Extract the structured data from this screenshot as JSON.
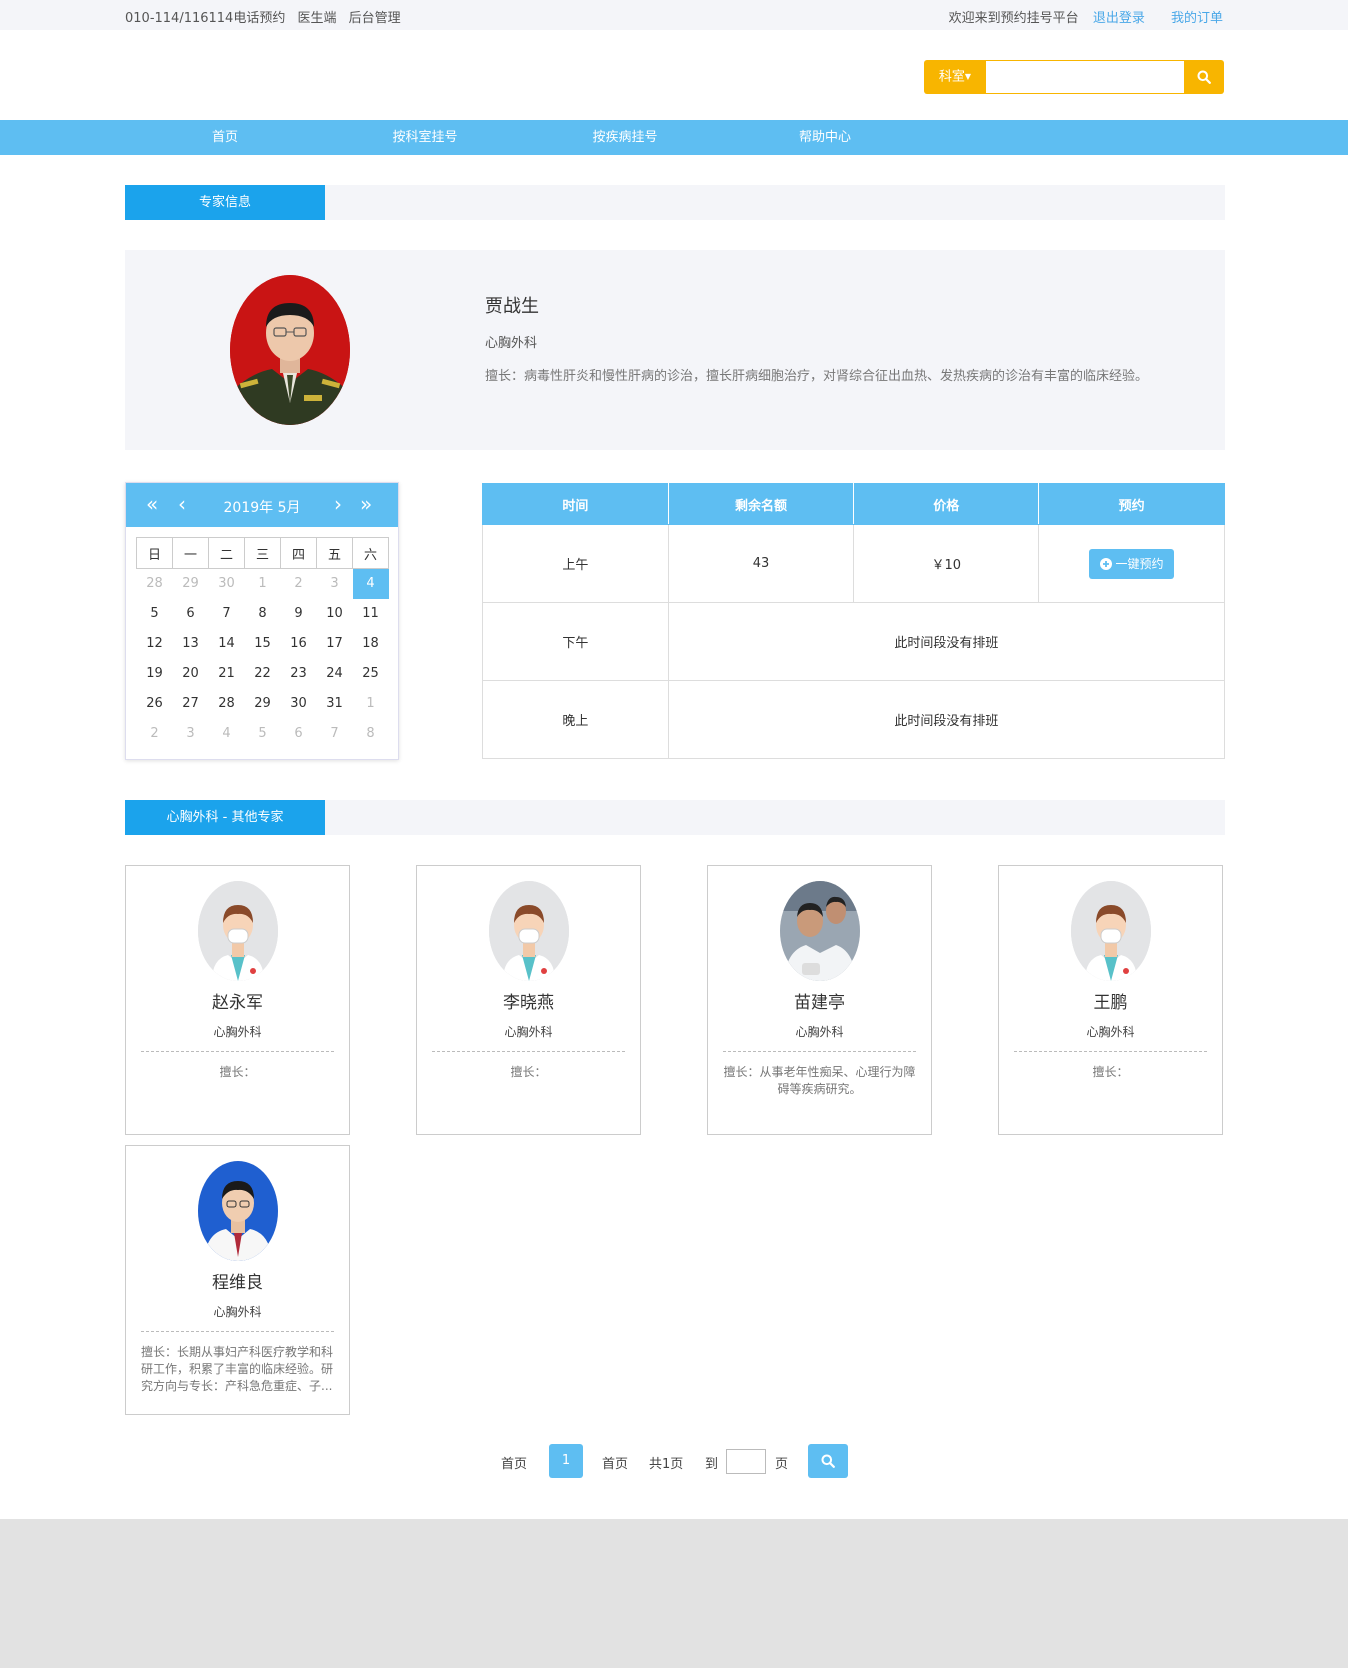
{
  "topbar": {
    "phone": "010-114/116114电话预约",
    "doctor_link": "医生端",
    "admin_link": "后台管理",
    "welcome": "欢迎来到预约挂号平台",
    "logout": "退出登录",
    "orders": "我的订单"
  },
  "search": {
    "dept_label": "科室",
    "placeholder": ""
  },
  "nav": [
    "首页",
    "按科室挂号",
    "按疾病挂号",
    "帮助中心"
  ],
  "sections": {
    "expert_info": "专家信息",
    "others": "心胸外科 - 其他专家"
  },
  "doctor": {
    "name": "贾战生",
    "dept": "心胸外科",
    "specialty": "擅长：病毒性肝炎和慢性肝病的诊治，擅长肝病细胞治疗，对肾综合征出血热、发热疾病的诊治有丰富的临床经验。"
  },
  "calendar": {
    "year_month": "2019年  5月",
    "weekdays": [
      "日",
      "一",
      "二",
      "三",
      "四",
      "五",
      "六"
    ],
    "weeks": [
      [
        {
          "d": "28",
          "m": 1
        },
        {
          "d": "29",
          "m": 1
        },
        {
          "d": "30",
          "m": 1
        },
        {
          "d": "1",
          "m": 1
        },
        {
          "d": "2",
          "m": 1
        },
        {
          "d": "3",
          "m": 1
        },
        {
          "d": "4",
          "s": 1
        }
      ],
      [
        {
          "d": "5"
        },
        {
          "d": "6"
        },
        {
          "d": "7"
        },
        {
          "d": "8"
        },
        {
          "d": "9"
        },
        {
          "d": "10"
        },
        {
          "d": "11"
        }
      ],
      [
        {
          "d": "12"
        },
        {
          "d": "13"
        },
        {
          "d": "14"
        },
        {
          "d": "15"
        },
        {
          "d": "16"
        },
        {
          "d": "17"
        },
        {
          "d": "18"
        }
      ],
      [
        {
          "d": "19"
        },
        {
          "d": "20"
        },
        {
          "d": "21"
        },
        {
          "d": "22"
        },
        {
          "d": "23"
        },
        {
          "d": "24"
        },
        {
          "d": "25"
        }
      ],
      [
        {
          "d": "26"
        },
        {
          "d": "27"
        },
        {
          "d": "28"
        },
        {
          "d": "29"
        },
        {
          "d": "30"
        },
        {
          "d": "31"
        },
        {
          "d": "1",
          "m": 1
        }
      ],
      [
        {
          "d": "2",
          "m": 1
        },
        {
          "d": "3",
          "m": 1
        },
        {
          "d": "4",
          "m": 1
        },
        {
          "d": "5",
          "m": 1
        },
        {
          "d": "6",
          "m": 1
        },
        {
          "d": "7",
          "m": 1
        },
        {
          "d": "8",
          "m": 1
        }
      ]
    ]
  },
  "schedule": {
    "headers": [
      "时间",
      "剩余名额",
      "价格",
      "预约"
    ],
    "morning": {
      "time": "上午",
      "remaining": "43",
      "price": "￥10",
      "book": "一键预约"
    },
    "afternoon": {
      "time": "下午",
      "note": "此时间段没有排班"
    },
    "evening": {
      "time": "晚上",
      "note": "此时间段没有排班"
    }
  },
  "others": [
    {
      "name": "赵永军",
      "dept": "心胸外科",
      "spec": "擅长："
    },
    {
      "name": "李晓燕",
      "dept": "心胸外科",
      "spec": "擅长："
    },
    {
      "name": "苗建亭",
      "dept": "心胸外科",
      "spec": "擅长：从事老年性痴呆、心理行为障碍等疾病研究。"
    },
    {
      "name": "王鹏",
      "dept": "心胸外科",
      "spec": "擅长："
    },
    {
      "name": "程维良",
      "dept": "心胸外科",
      "spec": "擅长：长期从事妇产科医疗教学和科研工作，积累了丰富的临床经验。研究方向与专长：产科急危重症、子..."
    }
  ],
  "pager": {
    "first": "首页",
    "current": "1",
    "last": "首页",
    "total": "共1页",
    "goto": "到",
    "page_unit": "页"
  },
  "colors": {
    "accent": "#5ebef2",
    "tab": "#1ba3ec",
    "search": "#f8b500"
  }
}
